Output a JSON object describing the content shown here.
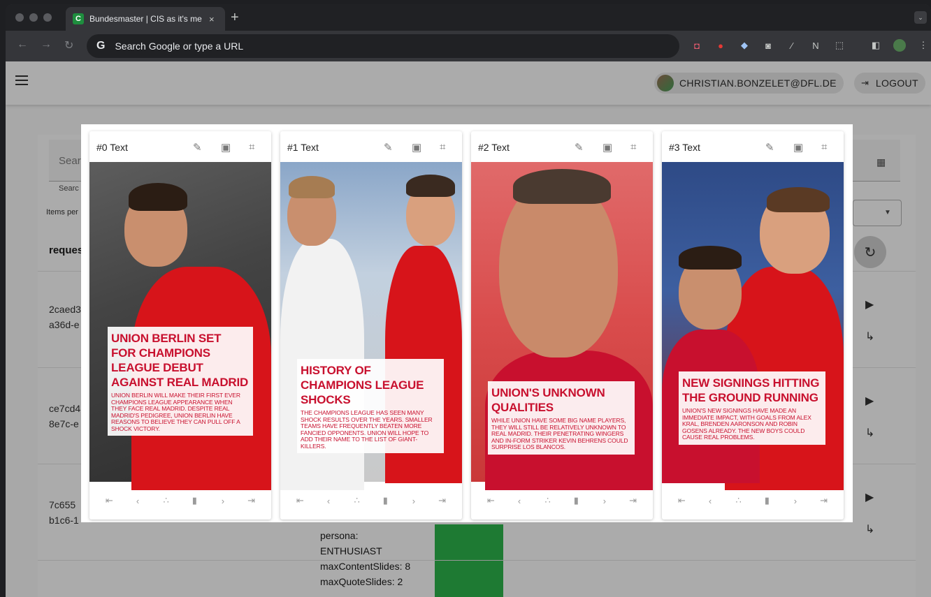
{
  "browser": {
    "tab_title": "Bundesmaster | CIS as it's me",
    "tab_favicon": "C",
    "tab_close": "×",
    "new_tab": "+",
    "tab_menu": "⌄",
    "omnibox_placeholder": "Search Google or type a URL"
  },
  "header": {
    "user_email": "CHRISTIAN.BONZELET@DFL.DE",
    "logout_label": "LOGOUT"
  },
  "background": {
    "search_label": "Sear",
    "search_hint": "Searc",
    "items_per_page": "Items per",
    "column_header": "reques",
    "rows": [
      {
        "id_line1": "2caed3",
        "id_line2": "a36d-e"
      },
      {
        "id_line1": "ce7cd4",
        "id_line2": "8e7c-e"
      },
      {
        "id_line1": "7c655",
        "id_line2": "b1c6-1"
      }
    ],
    "persona_lines": [
      "persona:",
      "ENTHUSIAST",
      "maxContentSlides: 8",
      "maxQuoteSlides: 2",
      "maxQuoteSlides: 2"
    ]
  },
  "slides": [
    {
      "title": "#0 Text",
      "headline": "UNION BERLIN SET FOR CHAMPIONS LEAGUE DEBUT AGAINST REAL MADRID",
      "body": "UNION BERLIN WILL MAKE THEIR FIRST EVER CHAMPIONS LEAGUE APPEARANCE WHEN THEY FACE REAL MADRID. DESPITE REAL MADRID'S PEDIGREE, UNION BERLIN HAVE REASONS TO BELIEVE THEY CAN PULL OFF A SHOCK VICTORY."
    },
    {
      "title": "#1 Text",
      "headline": "HISTORY OF CHAMPIONS LEAGUE SHOCKS",
      "body": "THE CHAMPIONS LEAGUE HAS SEEN MANY SHOCK RESULTS OVER THE YEARS. SMALLER TEAMS HAVE FREQUENTLY BEATEN MORE FANCIED OPPONENTS. UNION WILL HOPE TO ADD THEIR NAME TO THE LIST OF GIANT-KILLERS."
    },
    {
      "title": "#2 Text",
      "headline": "UNION'S UNKNOWN QUALITIES",
      "body": "WHILE UNION HAVE SOME BIG NAME PLAYERS, THEY WILL STILL BE RELATIVELY UNKNOWN TO REAL MADRID. THEIR PENETRATING WINGERS AND IN-FORM STRIKER KEVIN BEHRENS COULD SURPRISE LOS BLANCOS."
    },
    {
      "title": "#3 Text",
      "headline": "NEW SIGNINGS HITTING THE GROUND RUNNING",
      "body": "UNION'S NEW SIGNINGS HAVE MADE AN IMMEDIATE IMPACT, WITH GOALS FROM ALEX KRAL, BRENDEN AARONSON AND ROBIN GOSENS ALREADY. THE NEW BOYS COULD CAUSE REAL PROBLEMS."
    }
  ],
  "icons": {
    "edit": "✎",
    "image": "▣",
    "crop": "⌗",
    "first": "⇤",
    "prev": "‹",
    "shuffle": "∴",
    "delete": "▮",
    "next": "›",
    "last": "⇥",
    "refresh": "↻",
    "play": "▶",
    "subdirectory": "↳",
    "calendar": "▦",
    "logout": "⇥"
  },
  "colors": {
    "headline_red": "#c8102e",
    "union_red": "#d7141a",
    "status_green": "#1e7a33"
  }
}
